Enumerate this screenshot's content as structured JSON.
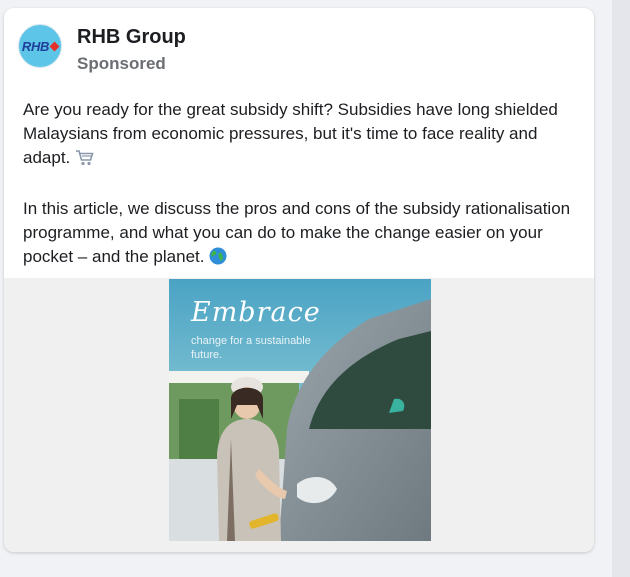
{
  "post": {
    "page_name": "RHB Group",
    "avatar_text": "RHB",
    "sponsored_label": "Sponsored",
    "paragraph_1": "Are you ready for the great subsidy shift? Subsidies have long shielded Malaysians from economic pressures, but it's time to face reality and adapt.",
    "paragraph_2": "In this article, we discuss the pros and cons of the subsidy rationalisation programme, and what you can do to make the change easier on your pocket – and the planet.",
    "emoji_1": "shopping-cart-icon",
    "emoji_2": "globe-icon"
  },
  "ad_image": {
    "headline": "Embrace",
    "subtext": "change for a sustainable future."
  },
  "colors": {
    "brand_blue": "#1f3f9a",
    "brand_red": "#e4322b",
    "avatar_bg": "#5cc5e8"
  }
}
